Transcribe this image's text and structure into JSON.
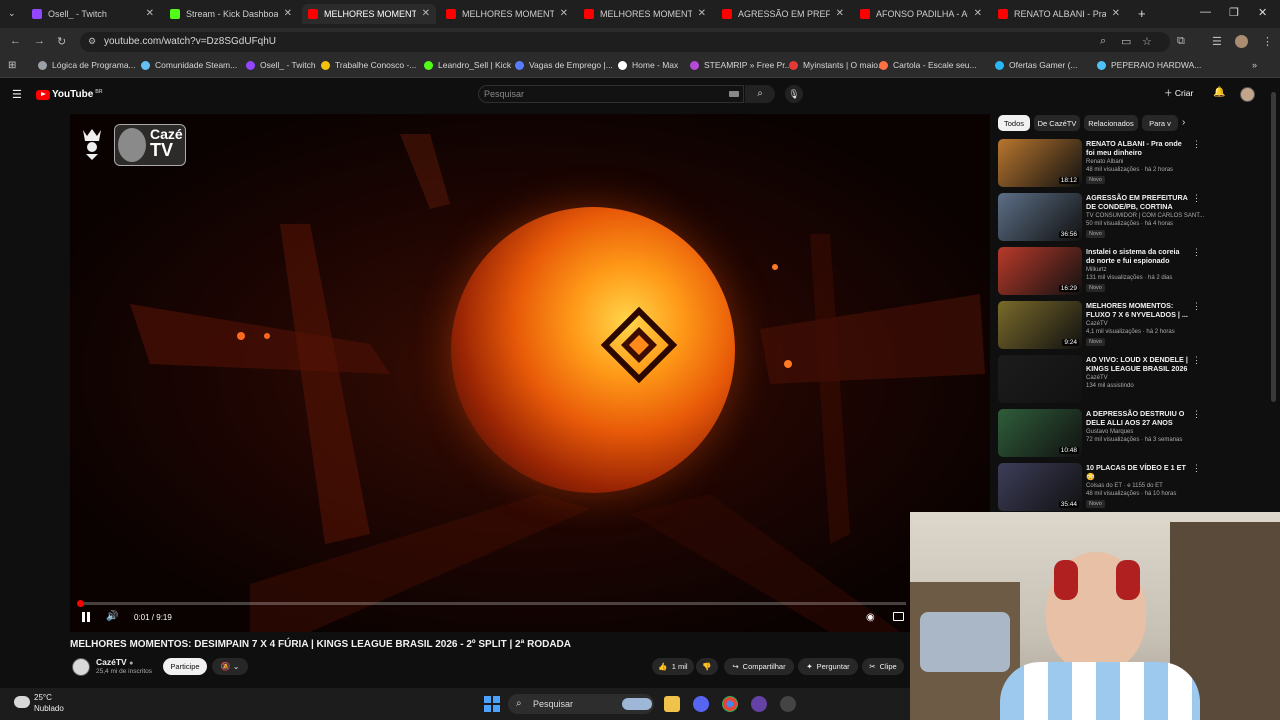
{
  "browser": {
    "tabs": [
      {
        "title": "Osell_ - Twitch",
        "color": "#9146ff"
      },
      {
        "title": "Stream - Kick Dashboard",
        "color": "#53fc18"
      },
      {
        "title": "MELHORES MOMENTO",
        "color": "#ff0000",
        "active": true
      },
      {
        "title": "MELHORES MOMENTOS:",
        "color": "#ff0000"
      },
      {
        "title": "MELHORES MOMENTOS:",
        "color": "#ff0000"
      },
      {
        "title": "AGRESSÃO EM PREFEITU",
        "color": "#ff0000"
      },
      {
        "title": "AFONSO PADILHA - ACAI",
        "color": "#ff0000"
      },
      {
        "title": "RENATO ALBANI - Pra on",
        "color": "#ff0000"
      }
    ],
    "url": "youtube.com/watch?v=Dz8SGdUFqhU",
    "bookmarks": [
      {
        "label": "Lógica de Programa...",
        "color": "#9aa0a6"
      },
      {
        "label": "Comunidade Steam...",
        "color": "#66c0f4"
      },
      {
        "label": "Osell_ - Twitch",
        "color": "#9146ff"
      },
      {
        "label": "Trabalhe Conosco -...",
        "color": "#f4c20d"
      },
      {
        "label": "Leandro_Sell | Kick",
        "color": "#53fc18"
      },
      {
        "label": "Vagas de Emprego |...",
        "color": "#5b7cfa"
      },
      {
        "label": "Home - Max",
        "color": "#ffffff"
      },
      {
        "label": "STEAMRIP » Free Pr...",
        "color": "#b44bd8"
      },
      {
        "label": "Myinstants | O maio...",
        "color": "#e53935"
      },
      {
        "label": "Cartola - Escale seu...",
        "color": "#ff7043"
      },
      {
        "label": "Ofertas Gamer (...",
        "color": "#29b6f6"
      },
      {
        "label": "PEPERAIO HARDWA...",
        "color": "#4fc3f7"
      }
    ]
  },
  "youtube": {
    "logo_text": "YouTube",
    "country_code": "BR",
    "search_placeholder": "Pesquisar",
    "create_label": "Criar"
  },
  "player": {
    "channel_logo_line1": "Cazé",
    "channel_logo_line2": "TV",
    "time": "0:01 / 9:19",
    "progress": 0.002
  },
  "video": {
    "title": "MELHORES MOMENTOS: DESIMPAIN 7 X 4 FÚRIA | KINGS LEAGUE BRASIL 2026 - 2º SPLIT | 2ª RODADA",
    "channel": "CazéTV",
    "subscribers": "25,4 mi de inscritos",
    "join_label": "Participe",
    "likes": "1 mil",
    "share_label": "Compartilhar",
    "ask_label": "Perguntar",
    "clip_label": "Clipe"
  },
  "filters": [
    "Todos",
    "De CazéTV",
    "Relacionados",
    "Para v"
  ],
  "recommendations": [
    {
      "title": "RENATO ALBANI - Pra onde foi meu dinheiro",
      "channel": "Renato Albani",
      "meta": "48 mil visualizações · há 2 horas",
      "badge": "Novo",
      "duration": "18:12",
      "color": "#b8762e"
    },
    {
      "title": "AGRESSÃO EM PREFEITURA DE CONDE/PB, CORTINA DE...",
      "channel": "TV CONSUMIDOR | COM CARLOS SANT...",
      "meta": "50 mil visualizações · há 4 horas",
      "badge": "Novo",
      "duration": "36:56",
      "color": "#5c6f86"
    },
    {
      "title": "Instalei o sistema da coreia do norte e fui espionado",
      "channel": "Milkurtz",
      "meta": "131 mil visualizações · há 2 dias",
      "badge": "Novo",
      "duration": "16:29",
      "color": "#b83a2a"
    },
    {
      "title": "MELHORES MOMENTOS: FLUXO 7 X 6 NYVELADOS | ...",
      "channel": "CazéTV",
      "meta": "4,1 mil visualizações · há 2 horas",
      "badge": "Novo",
      "duration": "9:24",
      "color": "#7a6a2a"
    },
    {
      "title": "AO VIVO: LOUD X DENDELE | KINGS LEAGUE BRASIL 2026 -...",
      "channel": "CazéTV",
      "meta": "134 mil assistindo",
      "badge": "",
      "duration": "",
      "color": "#1c1c1c"
    },
    {
      "title": "A DEPRESSÃO DESTRUIU O DELE ALLI AOS 27 ANOS",
      "channel": "Gustavo Marques",
      "meta": "72 mil visualizações · há 3 semanas",
      "badge": "",
      "duration": "10:48",
      "color": "#2f5e3a"
    },
    {
      "title": "10 PLACAS DE VÍDEO E 1 ET 😳",
      "channel": "Coisas do ET · e 1155 do ET",
      "meta": "48 mil visualizações · há 10 horas",
      "badge": "Novo",
      "duration": "35:44",
      "color": "#3d3d5a"
    }
  ],
  "taskbar": {
    "temperature": "25°C",
    "weather": "Nublado",
    "search_label": "Pesquisar"
  }
}
